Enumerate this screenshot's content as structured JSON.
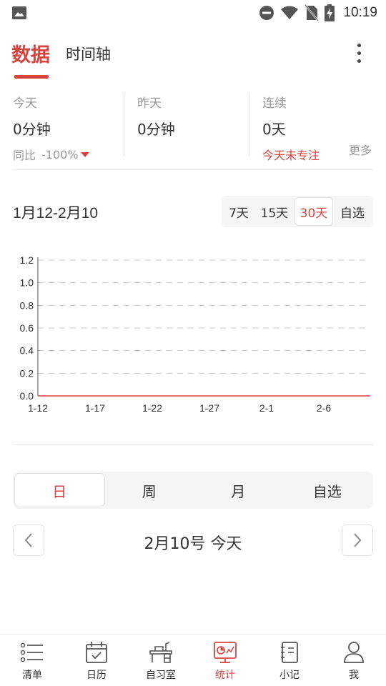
{
  "status_bar": {
    "time": "10:19"
  },
  "header": {
    "tabs": [
      {
        "label": "数据",
        "active": true
      },
      {
        "label": "时间轴",
        "active": false
      }
    ]
  },
  "summary": {
    "today": {
      "label": "今天",
      "value": "0分钟",
      "compare_label": "同比",
      "compare_value": "-100%"
    },
    "yesterday": {
      "label": "昨天",
      "value": "0分钟"
    },
    "streak": {
      "label": "连续",
      "value": "0天",
      "status": "今天未专注",
      "more": "更多"
    }
  },
  "range": {
    "title": "1月12-2月10",
    "options": [
      "7天",
      "15天",
      "30天",
      "自选"
    ],
    "selected": "30天"
  },
  "chart_data": {
    "type": "line",
    "x_tick_labels": [
      "1-12",
      "1-17",
      "1-22",
      "1-27",
      "2-1",
      "2-6"
    ],
    "y_tick_labels": [
      "0.0",
      "0.2",
      "0.4",
      "0.6",
      "0.8",
      "1.0",
      "1.2"
    ],
    "ylim": [
      0,
      1.2
    ],
    "x": [
      "1-12",
      "1-13",
      "1-14",
      "1-15",
      "1-16",
      "1-17",
      "1-18",
      "1-19",
      "1-20",
      "1-21",
      "1-22",
      "1-23",
      "1-24",
      "1-25",
      "1-26",
      "1-27",
      "1-28",
      "1-29",
      "1-30",
      "1-31",
      "2-1",
      "2-2",
      "2-3",
      "2-4",
      "2-5",
      "2-6",
      "2-7",
      "2-8",
      "2-9",
      "2-10"
    ],
    "values": [
      0,
      0,
      0,
      0,
      0,
      0,
      0,
      0,
      0,
      0,
      0,
      0,
      0,
      0,
      0,
      0,
      0,
      0,
      0,
      0,
      0,
      0,
      0,
      0,
      0,
      0,
      0,
      0,
      0,
      0
    ],
    "grid": "horizontal dashed",
    "line_color": "#d9433f"
  },
  "period": {
    "options": [
      "日",
      "周",
      "月",
      "自选"
    ],
    "selected": "日"
  },
  "date_nav": {
    "label": "2月10号 今天"
  },
  "bottom_nav": [
    {
      "label": "清单",
      "icon": "list-icon",
      "active": false
    },
    {
      "label": "日历",
      "icon": "calendar-icon",
      "active": false
    },
    {
      "label": "自习室",
      "icon": "study-room-icon",
      "active": false
    },
    {
      "label": "统计",
      "icon": "statistics-icon",
      "active": true
    },
    {
      "label": "小记",
      "icon": "notebook-icon",
      "active": false
    },
    {
      "label": "我",
      "icon": "profile-icon",
      "active": false
    }
  ],
  "colors": {
    "accent": "#d9433f",
    "text": "#333333",
    "muted": "#999999"
  }
}
